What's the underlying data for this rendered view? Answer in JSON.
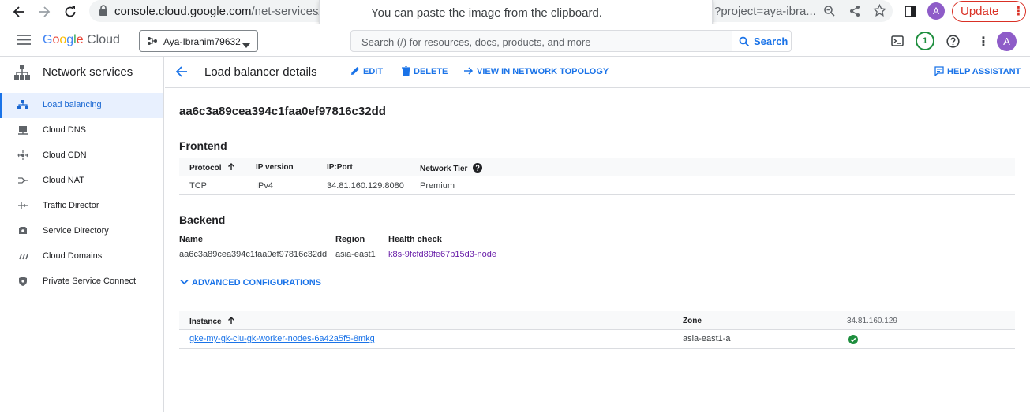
{
  "browser": {
    "url_host": "console.cloud.google.com",
    "url_path": "/net-services/lo",
    "url_tail": "?project=aya-ibra...",
    "update_label": "Update",
    "profile_initial": "A",
    "toast": "You can paste the image from the clipboard."
  },
  "header": {
    "brand": "Google Cloud",
    "project": "Aya-Ibrahim79632",
    "search_placeholder": "Search (/) for resources, docs, products, and more",
    "search_button": "Search",
    "notification_count": "1",
    "avatar_initial": "A"
  },
  "sidebar": {
    "title": "Network services",
    "items": [
      {
        "label": "Load balancing",
        "icon": "load-balancing-icon",
        "active": true
      },
      {
        "label": "Cloud DNS",
        "icon": "cloud-dns-icon"
      },
      {
        "label": "Cloud CDN",
        "icon": "cloud-cdn-icon"
      },
      {
        "label": "Cloud NAT",
        "icon": "cloud-nat-icon"
      },
      {
        "label": "Traffic Director",
        "icon": "traffic-director-icon"
      },
      {
        "label": "Service Directory",
        "icon": "service-directory-icon"
      },
      {
        "label": "Cloud Domains",
        "icon": "cloud-domains-icon"
      },
      {
        "label": "Private Service Connect",
        "icon": "private-service-connect-icon"
      }
    ]
  },
  "page": {
    "title": "Load balancer details",
    "actions": {
      "edit": "EDIT",
      "delete": "DELETE",
      "topology": "VIEW IN NETWORK TOPOLOGY",
      "help": "HELP ASSISTANT"
    },
    "lb_name": "aa6c3a89cea394c1faa0ef97816c32dd"
  },
  "frontend": {
    "title": "Frontend",
    "columns": [
      "Protocol",
      "IP version",
      "IP:Port",
      "Network Tier"
    ],
    "rows": [
      [
        "TCP",
        "IPv4",
        "34.81.160.129:8080",
        "Premium"
      ]
    ]
  },
  "backend": {
    "title": "Backend",
    "name_label": "Name",
    "name_value": "aa6c3a89cea394c1faa0ef97816c32dd",
    "region_label": "Region",
    "region_value": "asia-east1",
    "health_label": "Health check",
    "health_value": "k8s-9fcfd89fe67b15d3-node",
    "advanced": "ADVANCED CONFIGURATIONS"
  },
  "instances": {
    "columns": [
      "Instance",
      "Zone",
      "34.81.160.129"
    ],
    "rows": [
      {
        "instance": "gke-my-gk-clu-gk-worker-nodes-6a42a5f5-8mkg",
        "zone": "asia-east1-a",
        "healthy": true
      }
    ]
  },
  "colors": {
    "accent": "#1a73e8",
    "visited_link": "#681da8",
    "health_ok": "#1e8e3e",
    "update_red": "#d93025"
  }
}
